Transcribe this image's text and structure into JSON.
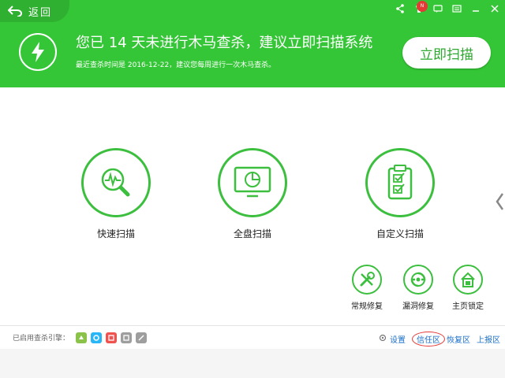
{
  "header": {
    "back_label": "返回",
    "headline": "您已 14 天未进行木马查杀，建议立即扫描系统",
    "subline": "最近查杀时间是 2016-12-22，建议您每周进行一次木马查杀。",
    "scan_now_label": "立即扫描",
    "accent_color": "#34c636",
    "notification_badge": "N"
  },
  "scans": [
    {
      "label": "快速扫描",
      "icon": "quick-scan-icon"
    },
    {
      "label": "全盘扫描",
      "icon": "full-scan-icon"
    },
    {
      "label": "自定义扫描",
      "icon": "custom-scan-icon"
    }
  ],
  "tools": [
    {
      "label": "常规修复",
      "icon": "wrench-screwdriver-icon"
    },
    {
      "label": "漏洞修复",
      "icon": "vulnerability-repair-icon"
    },
    {
      "label": "主页锁定",
      "icon": "home-lock-icon"
    }
  ],
  "footer": {
    "engine_label": "已启用查杀引擎：",
    "engines": [
      {
        "name": "cloud-engine-icon",
        "color": "#8bc34a"
      },
      {
        "name": "qvm-engine-icon",
        "color": "#29b6f6"
      },
      {
        "name": "system-repair-engine-icon",
        "color": "#ef5350"
      },
      {
        "name": "engine-4-icon",
        "color": "#9e9e9e"
      },
      {
        "name": "engine-5-icon",
        "color": "#9e9e9e"
      }
    ],
    "links": {
      "settings": "设置",
      "trust_zone": "信任区",
      "restore_zone": "恢复区",
      "report_zone": "上报区"
    }
  }
}
